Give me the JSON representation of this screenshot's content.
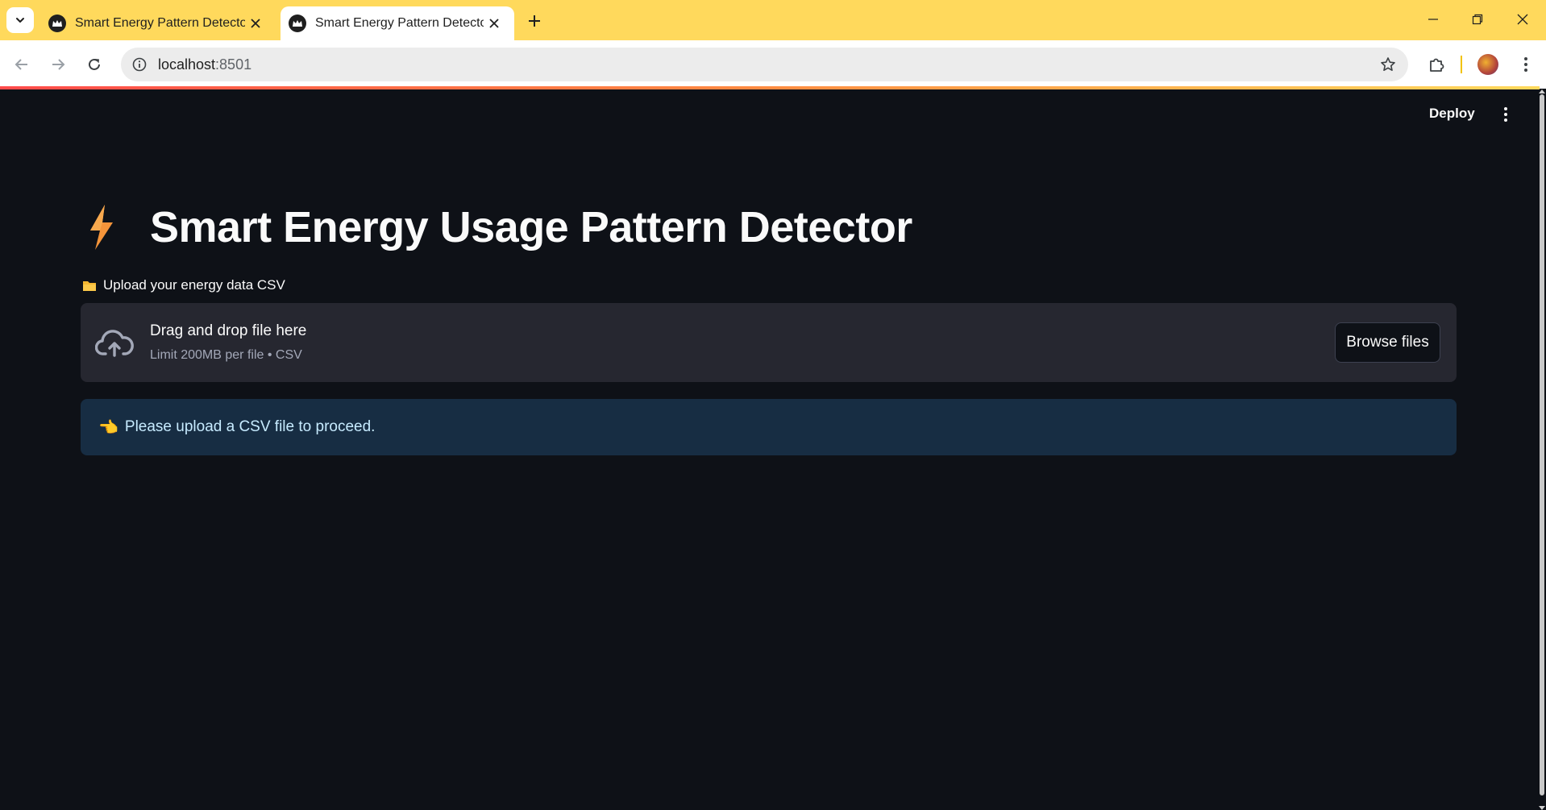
{
  "browser": {
    "tabs": [
      {
        "title": "Smart Energy Pattern Detector",
        "active": false
      },
      {
        "title": "Smart Energy Pattern Detector",
        "active": true
      }
    ],
    "url_host": "localhost",
    "url_port": ":8501"
  },
  "app": {
    "deploy_label": "Deploy",
    "title": "Smart Energy Usage Pattern Detector",
    "uploader": {
      "label": "Upload your energy data CSV",
      "drop_title": "Drag and drop file here",
      "drop_subtitle": "Limit 200MB per file • CSV",
      "browse_label": "Browse files"
    },
    "info_message": "Please upload a CSV file to proceed."
  },
  "icons": {
    "title_emoji": "high-voltage-icon",
    "label_emoji": "folder-icon",
    "info_emoji": "pointing-hand-icon"
  },
  "colors": {
    "chrome_frame": "#ffd95c",
    "app_background": "#0e1117",
    "dropzone_background": "#262730",
    "info_background": "#172d43",
    "info_text": "#c7ebff"
  }
}
